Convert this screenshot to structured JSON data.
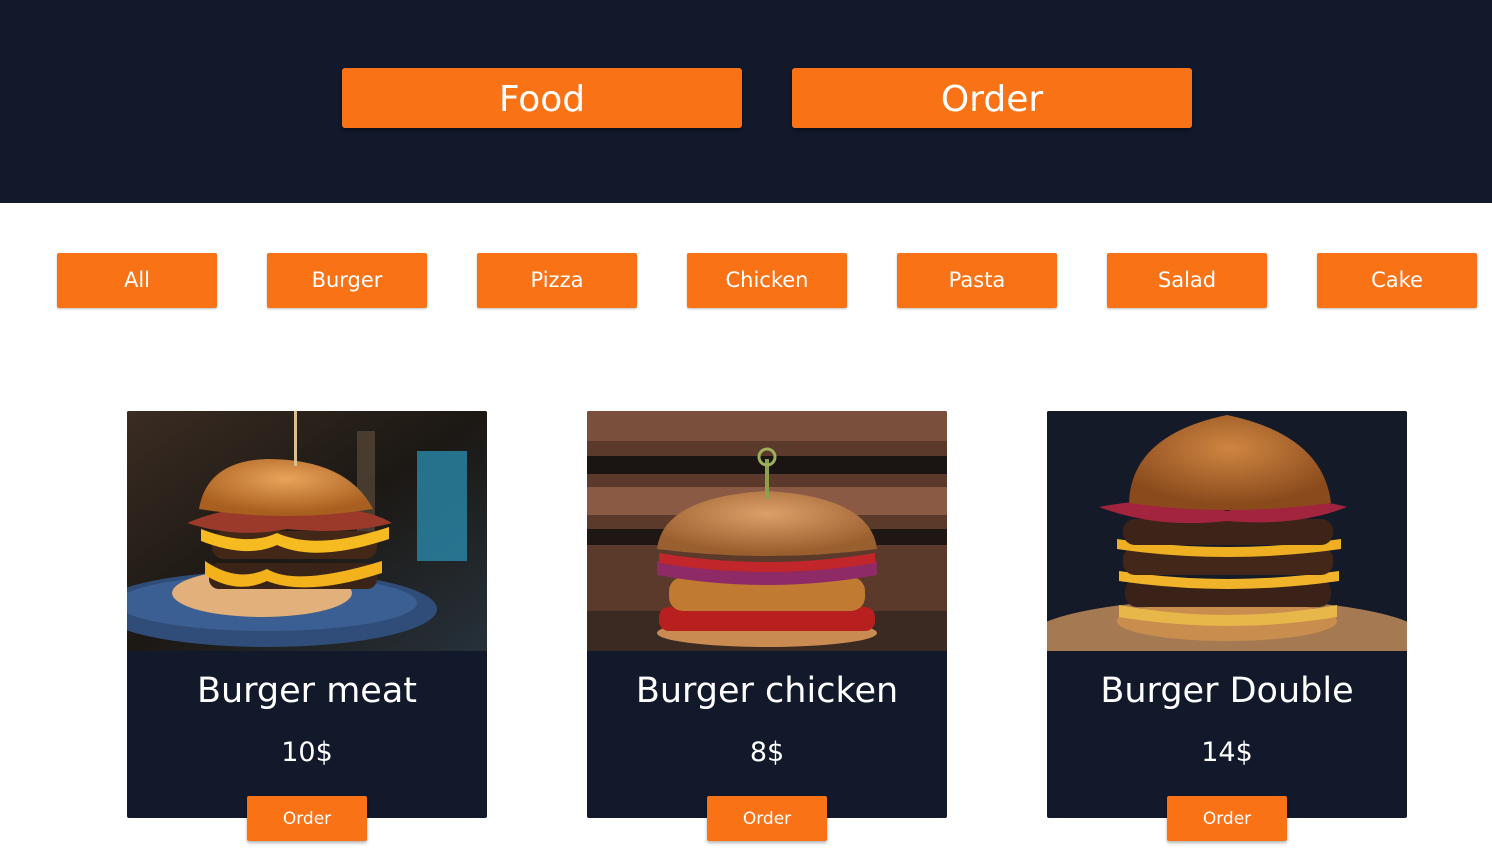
{
  "header": {
    "nav": [
      {
        "label": "Food"
      },
      {
        "label": "Order"
      }
    ]
  },
  "filters": [
    {
      "label": "All"
    },
    {
      "label": "Burger"
    },
    {
      "label": "Pizza"
    },
    {
      "label": "Chicken"
    },
    {
      "label": "Pasta"
    },
    {
      "label": "Salad"
    },
    {
      "label": "Cake"
    }
  ],
  "products": [
    {
      "name": "Burger meat",
      "price": "10$",
      "order_label": "Order",
      "image": "burger-meat-photo"
    },
    {
      "name": "Burger chicken",
      "price": "8$",
      "order_label": "Order",
      "image": "burger-chicken-photo"
    },
    {
      "name": "Burger Double",
      "price": "14$",
      "order_label": "Order",
      "image": "burger-double-photo"
    }
  ],
  "colors": {
    "header_bg": "#11192b",
    "accent": "#f97316",
    "card_bg": "#11192b",
    "page_bg": "#ffffff",
    "text_light": "#ffffff"
  }
}
